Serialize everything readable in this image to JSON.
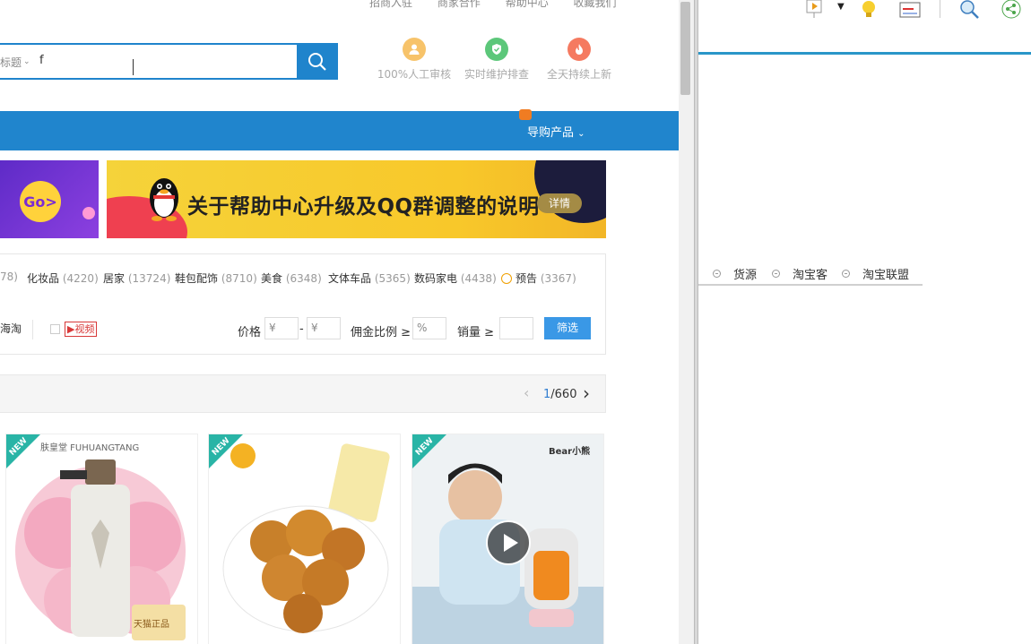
{
  "top_links": [
    "招商入驻",
    "商家合作",
    "帮助中心",
    "收藏我们"
  ],
  "search": {
    "prefix": "标题",
    "value": "f",
    "button_label": "search"
  },
  "features": [
    {
      "label": "100%人工审核",
      "color": "#f5b54a"
    },
    {
      "label": "实时维护排查",
      "color": "#4cc06b"
    },
    {
      "label": "全天持续上新",
      "color": "#f2644a"
    }
  ],
  "nav": {
    "product_label": "导购产品"
  },
  "banner": {
    "go_label": "Go>",
    "headline": "关于帮助中心升级及QQ群调整的说明",
    "detail_button": "详情"
  },
  "categories": [
    {
      "name": "78)",
      "count": ""
    },
    {
      "name": "化妆品",
      "count": "(4220)"
    },
    {
      "name": "居家",
      "count": "(13724)"
    },
    {
      "name": "鞋包配饰",
      "count": "(8710)"
    },
    {
      "name": "美食",
      "count": "(6348)"
    },
    {
      "name": "文体车品",
      "count": "(5365)"
    },
    {
      "name": "数码家电",
      "count": "(4438)"
    },
    {
      "name": "预告",
      "count": "(3367)"
    }
  ],
  "filters": {
    "overseas_label": "海淘",
    "video_label": "▶视频",
    "price_label": "价格",
    "price_min_placeholder": "¥",
    "price_sep": "-",
    "price_max_placeholder": "¥",
    "commission_label": "佣金比例 ≥",
    "commission_placeholder": "%",
    "sales_label": "销量 ≥",
    "submit_label": "筛选"
  },
  "pager": {
    "current": "1",
    "total": "/660"
  },
  "products": [
    {
      "badge": "NEW",
      "brand": "肤皇堂 FUHUANGTANG",
      "tag": "天猫正品"
    },
    {
      "badge": "NEW",
      "brand": "",
      "tag": ""
    },
    {
      "badge": "NEW",
      "brand": "Bear小熊",
      "tag": ""
    }
  ],
  "right_pane": {
    "tabs": [
      "货源",
      "淘宝客",
      "淘宝联盟"
    ]
  }
}
